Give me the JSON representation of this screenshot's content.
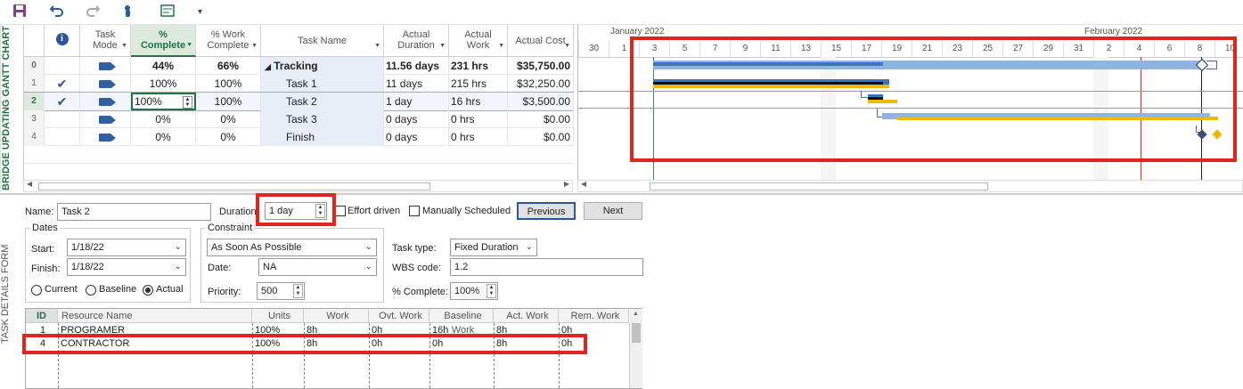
{
  "qat": {
    "save_icon": "save-icon",
    "undo_icon": "undo-icon",
    "redo_icon": "redo-icon",
    "touch_icon": "touch-mode-icon",
    "form_icon": "form-icon",
    "more_icon": "customize-qat-icon"
  },
  "view_label_top": "BRIDGE UPDATING GANTT CHART",
  "view_label_bottom": "TASK DETAILS FORM",
  "grid": {
    "columns": {
      "mode_l1": "Task",
      "mode_l2": "Mode",
      "pc_l1": "%",
      "pc_l2": "Complete",
      "pw_l1": "% Work",
      "pw_l2": "Complete",
      "name": "Task Name",
      "dur_l1": "Actual",
      "dur_l2": "Duration",
      "work_l1": "Actual",
      "work_l2": "Work",
      "cost": "Actual Cost"
    },
    "rows": [
      {
        "id": "0",
        "check": "",
        "pc": "44%",
        "pw": "66%",
        "name": "Tracking",
        "dur": "11.56 days",
        "work": "231 hrs",
        "cost": "$35,750.00"
      },
      {
        "id": "1",
        "check": "✔",
        "pc": "100%",
        "pw": "100%",
        "name": "Task 1",
        "dur": "11 days",
        "work": "215 hrs",
        "cost": "$32,250.00"
      },
      {
        "id": "2",
        "check": "✔",
        "pc": "100%",
        "pw": "100%",
        "name": "Task 2",
        "dur": "1 day",
        "work": "16 hrs",
        "cost": "$3,500.00"
      },
      {
        "id": "3",
        "check": "",
        "pc": "0%",
        "pw": "0%",
        "name": "Task 3",
        "dur": "0 days",
        "work": "0 hrs",
        "cost": "$0.00"
      },
      {
        "id": "4",
        "check": "",
        "pc": "0%",
        "pw": "0%",
        "name": "Finish",
        "dur": "0 days",
        "work": "0 hrs",
        "cost": "$0.00"
      }
    ],
    "summary_marker": "◢"
  },
  "gantt": {
    "month1": "January 2022",
    "month2": "February 2022",
    "ticks": [
      "30",
      "1",
      "3",
      "5",
      "7",
      "9",
      "11",
      "13",
      "15",
      "17",
      "19",
      "21",
      "23",
      "25",
      "27",
      "29",
      "31",
      "2",
      "4",
      "6",
      "8",
      "10"
    ],
    "colors": {
      "actual": "#3b74c4",
      "remaining": "#8fb4e3",
      "baseline": "#f2b705",
      "critical_line": "#e3241b"
    }
  },
  "form": {
    "name_label": "Name:",
    "name_value": "Task 2",
    "duration_label": "Duration:",
    "duration_value": "1 day",
    "effort_label": "Effort driven",
    "manual_label": "Manually Scheduled",
    "previous": "Previous",
    "next": "Next",
    "dates_title": "Dates",
    "start_label": "Start:",
    "start_value": "1/18/22",
    "finish_label": "Finish:",
    "finish_value": "1/18/22",
    "current_label": "Current",
    "baseline_label": "Baseline",
    "actual_label": "Actual",
    "constraint_title": "Constraint",
    "constraint_value": "As Soon As Possible",
    "date_label": "Date:",
    "date_value": "NA",
    "priority_label": "Priority:",
    "priority_value": "500",
    "tasktype_label": "Task type:",
    "tasktype_value": "Fixed Duration",
    "wbs_label": "WBS code:",
    "wbs_value": "1.2",
    "pc_label": "% Complete:",
    "pc_value": "100%"
  },
  "resources": {
    "headers": [
      "ID",
      "Resource Name",
      "Units",
      "Work",
      "Ovt. Work",
      "Baseline Work",
      "Act. Work",
      "Rem. Work"
    ],
    "rows": [
      [
        "1",
        "PROGRAMER",
        "100%",
        "8h",
        "0h",
        "16h",
        "8h",
        "0h"
      ],
      [
        "4",
        "CONTRACTOR",
        "100%",
        "8h",
        "0h",
        "0h",
        "8h",
        "0h"
      ]
    ]
  }
}
